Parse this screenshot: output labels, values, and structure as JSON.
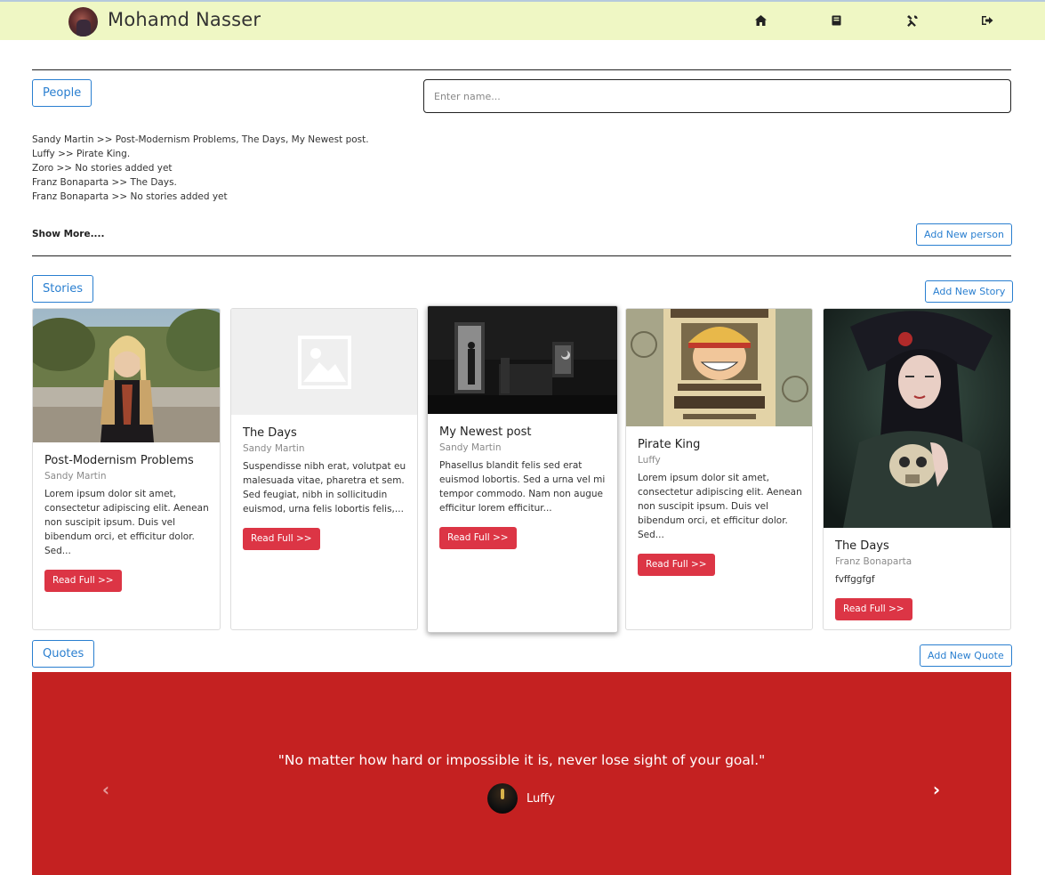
{
  "navbar": {
    "brand": "Mohamd Nasser",
    "icons": [
      "home-icon",
      "book-icon",
      "tools-icon",
      "sign-out-icon"
    ]
  },
  "people": {
    "button_label": "People",
    "search_placeholder": "Enter name...",
    "list": [
      "Sandy Martin >> Post-Modernism Problems, The Days, My Newest post.",
      "Luffy >> Pirate King.",
      "Zoro >> No stories added yet",
      "Franz Bonaparta >> The Days.",
      "Franz Bonaparta >> No stories added yet"
    ],
    "show_more": "Show More....",
    "add_button": "Add New person"
  },
  "stories": {
    "button_label": "Stories",
    "add_button": "Add New Story",
    "cards": [
      {
        "title": "Post-Modernism Problems",
        "author": "Sandy Martin",
        "text": "Lorem ipsum dolor sit amet, consectetur adipiscing elit. Aenean non suscipit ipsum. Duis vel bibendum orci, et efficitur dolor. Sed...",
        "button": "Read Full >>"
      },
      {
        "title": "The Days",
        "author": "Sandy Martin",
        "text": "Suspendisse nibh erat, volutpat eu malesuada vitae, pharetra et sem. Sed feugiat, nibh in sollicitudin euismod, urna felis lobortis felis,...",
        "button": "Read Full >>"
      },
      {
        "title": "My Newest post",
        "author": "Sandy Martin",
        "text": "Phasellus blandit felis sed erat euismod lobortis. Sed a urna vel mi tempor commodo. Nam non augue efficitur lorem efficitur...",
        "button": "Read Full >>"
      },
      {
        "title": "Pirate King",
        "author": "Luffy",
        "text": "Lorem ipsum dolor sit amet, consectetur adipiscing elit. Aenean non suscipit ipsum. Duis vel bibendum orci, et efficitur dolor. Sed...",
        "button": "Read Full >>"
      },
      {
        "title": "The Days",
        "author": "Franz Bonaparta",
        "text": "fvffggfgf",
        "button": "Read Full >>"
      }
    ]
  },
  "quotes": {
    "button_label": "Quotes",
    "add_button": "Add New Quote",
    "quote": "\"No matter how hard or impossible it is, never lose sight of your goal.\"",
    "author": "Luffy",
    "prev": "‹",
    "next": "›"
  },
  "colors": {
    "navbar_bg": "#eff7c4",
    "primary": "#2a7fd0",
    "danger": "#dc3545",
    "carousel_bg": "#c42121"
  }
}
